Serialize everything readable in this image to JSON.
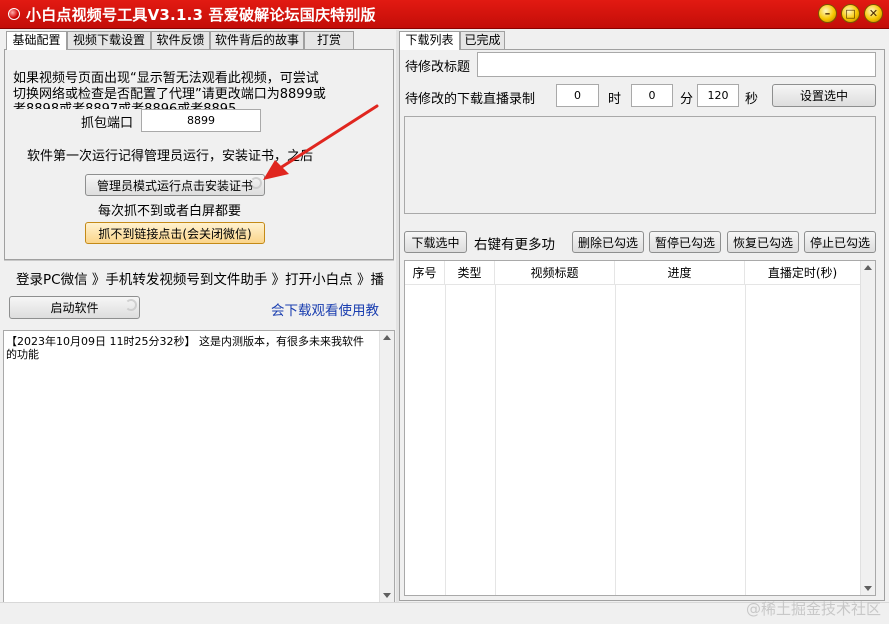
{
  "window": {
    "title": "小白点视频号工具V3.1.3 吾爱破解论坛国庆特别版"
  },
  "left_tabs": [
    "基础配置",
    "视频下载设置",
    "软件反馈",
    "软件背后的故事",
    "打赏"
  ],
  "basic_config": {
    "notice_line1": "如果视频号页面出现“显示暂无法观看此视频，可尝试",
    "notice_line2": "切换网络或检查是否配置了代理”请更改端口为8899或",
    "notice_line3": "者8898或者8897或者8896或者8895",
    "port_label": "抓包端口",
    "port_value": "8899",
    "first_run_notice": "软件第一次运行记得管理员运行，安装证书，之后",
    "install_cert_button": "管理员模式运行点击安装证书",
    "capture_hint": "每次抓不到或者白屏都要",
    "capture_fail_button": "抓不到链接点击(会关闭微信)"
  },
  "steps_text": "登录PC微信 》手机转发视频号到文件助手 》打开小白点 》播",
  "start_button": "启动软件",
  "tutorial_link": "会下载观看使用教",
  "log": {
    "line1": "【2023年10月09日 11时25分32秒】 这是内测版本，有很多未来我软件",
    "line2": "的功能"
  },
  "right_tabs": [
    "下载列表",
    "已完成"
  ],
  "edit_title_label": "待修改标题",
  "edit_title_value": "",
  "live_record_label": "待修改的下载直播录制",
  "hour_value": "0",
  "hour_unit": "时",
  "minute_value": "0",
  "minute_unit": "分",
  "second_value": "120",
  "second_unit": "秒",
  "set_selected_button": "设置选中",
  "actions": {
    "download_selected": "下载选中",
    "more_hint": "右键有更多功",
    "delete_checked": "删除已勾选",
    "pause_checked": "暂停已勾选",
    "resume_checked": "恢复已勾选",
    "stop_checked": "停止已勾选"
  },
  "table": {
    "columns": [
      "序号",
      "类型",
      "视频标题",
      "进度",
      "直播定时(秒)"
    ]
  },
  "watermark": "@稀土掘金技术社区",
  "colors": {
    "titlebar": "#d4140d",
    "arrow": "#e0261f"
  }
}
